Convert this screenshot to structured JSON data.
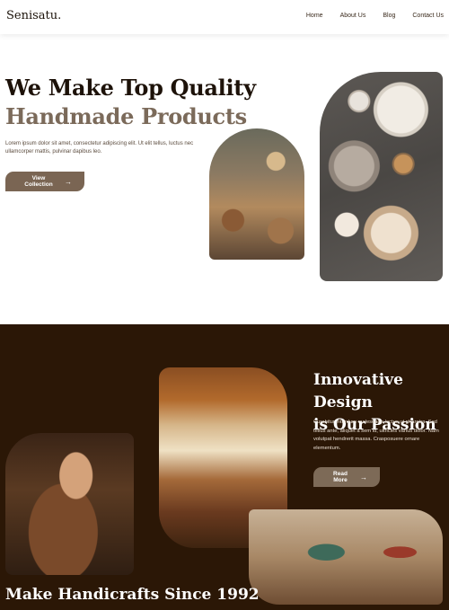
{
  "header": {
    "logo": "Senisatu.",
    "nav": [
      "Home",
      "About Us",
      "Blog",
      "Contact Us"
    ]
  },
  "hero": {
    "title_line1": "We Make Top Quality",
    "title_line2": "Handmade Products",
    "text": "Lorem ipsum dolor sit amet, consectetur adipiscing elit. Ut elit tellus, luctus nec ullamcorper mattis, pulvinar dapibus leo.",
    "button_label": "View Collection",
    "button_icon": "→"
  },
  "passion": {
    "title_line1": "Innovative Design",
    "title_line2": "is Our Passion",
    "text": "Curabitur interdum malesuada lectus ut pharetra. Sed tellus ante, aliquet a sem id, ultricies varius dolor. Nam volutpat hendrerit massa. Crasposuere ornare elementum.",
    "button_label": "Read More",
    "button_icon": "→"
  },
  "bottom": {
    "title": "Make Handicrafts Since 1992"
  },
  "colors": {
    "accent_button": "#7a6553",
    "dark_section": "#2b1706",
    "muted_title": "#7b6a5a"
  }
}
